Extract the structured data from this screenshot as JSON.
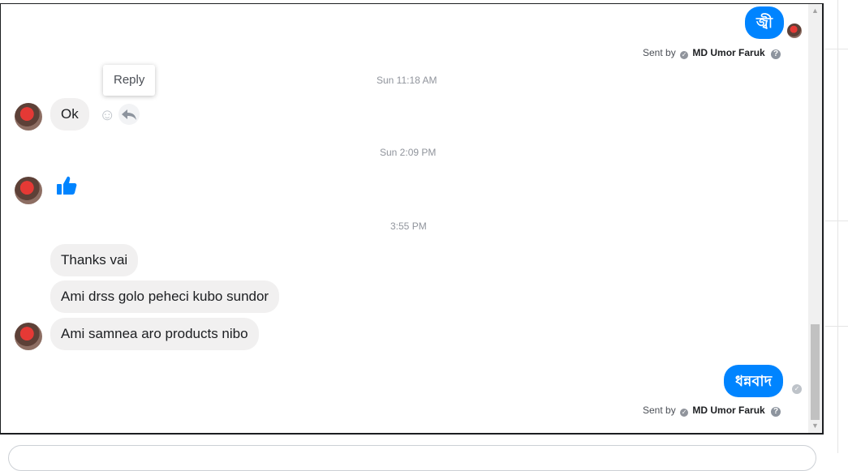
{
  "conversation": {
    "first_out": {
      "text": "জ্বী"
    },
    "sent_by_1": {
      "prefix": "Sent by",
      "name": "MD Umor Faruk",
      "help": "?"
    },
    "tooltip": {
      "label": "Reply"
    },
    "ts1": "Sun 11:18 AM",
    "msg_ok": "Ok",
    "ts2": "Sun 2:09 PM",
    "like": "like-thumb",
    "ts3": "3:55 PM",
    "msg1": "Thanks vai",
    "msg2": "Ami drss golo peheci kubo sundor",
    "msg3": "Ami samnea aro products nibo",
    "last_out": {
      "text": "ধন্নবাদ"
    },
    "sent_by_2": {
      "prefix": "Sent by",
      "name": "MD Umor Faruk",
      "help": "?"
    }
  },
  "colors": {
    "accent": "#0084ff",
    "incoming": "#f1f0f0",
    "timestamp": "#90949c"
  },
  "icons": [
    "smiley-icon",
    "reply-icon",
    "like-icon",
    "help-icon",
    "check-icon",
    "scroll-up-icon",
    "scroll-down-icon"
  ]
}
